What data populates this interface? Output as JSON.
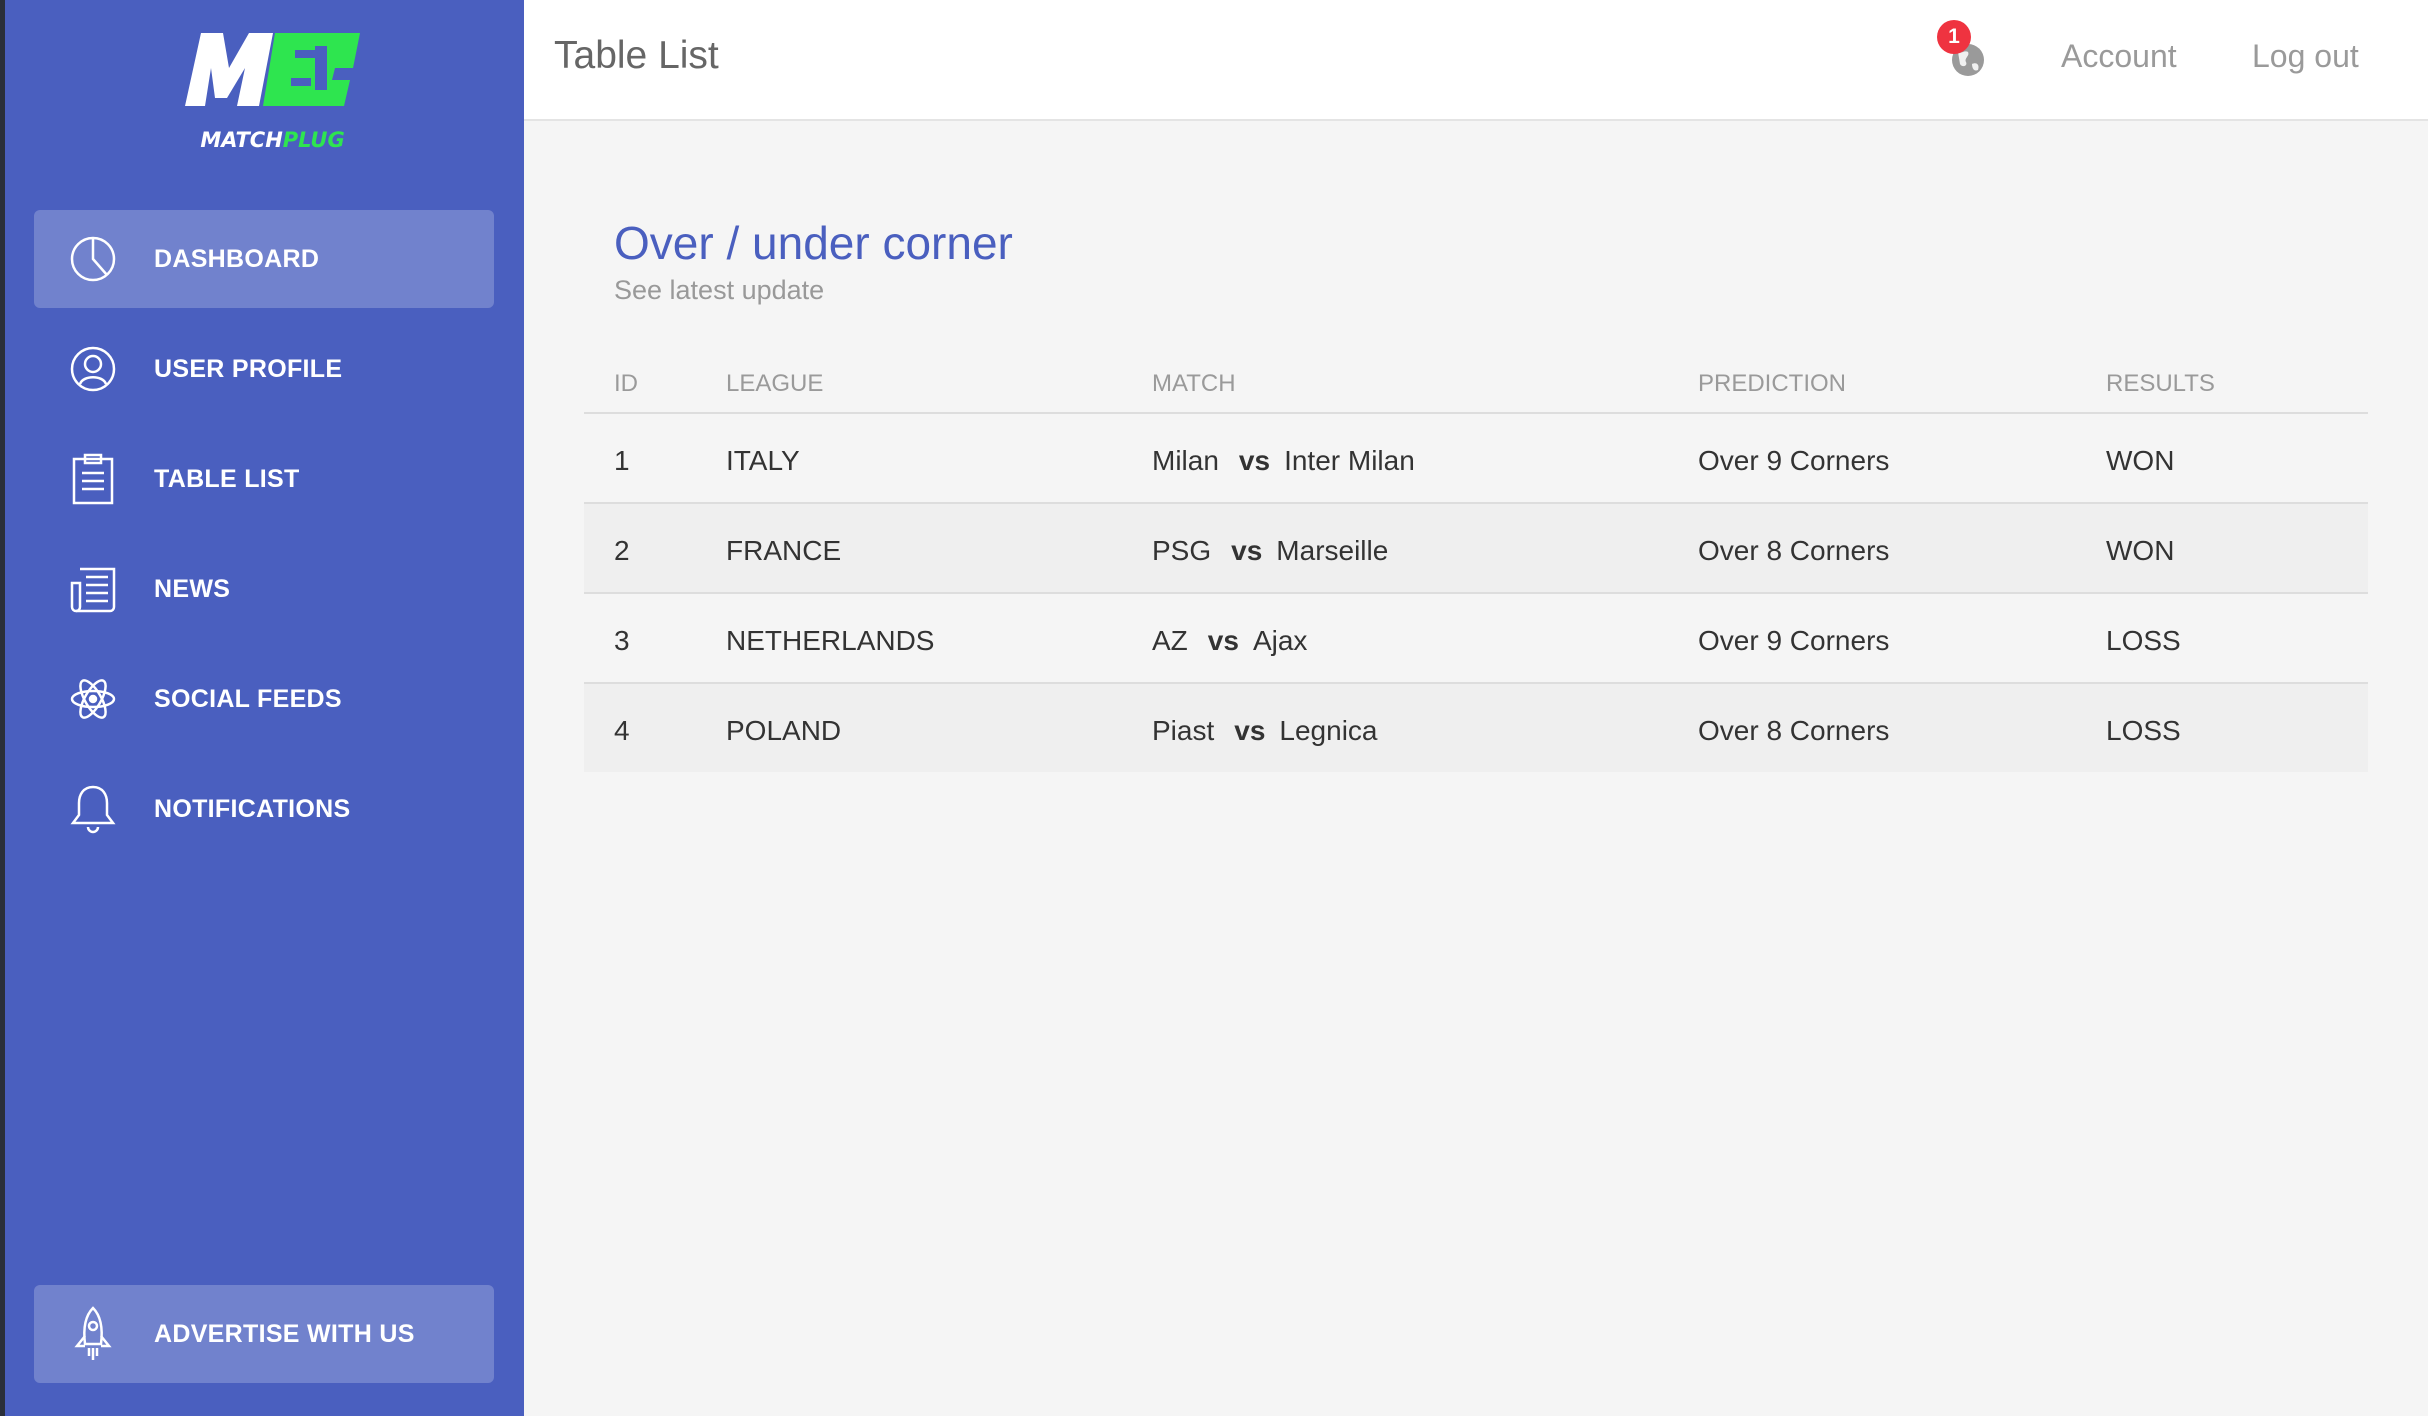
{
  "brand": {
    "logo_text_white": "MATCH",
    "logo_text_green": "PLUG",
    "brand_green": "#2ee54f",
    "sidebar_color": "#4a5fbf"
  },
  "sidebar": {
    "items": [
      {
        "label": "DASHBOARD",
        "icon": "pie-chart-icon",
        "active": true
      },
      {
        "label": "USER PROFILE",
        "icon": "user-icon"
      },
      {
        "label": "TABLE LIST",
        "icon": "clipboard-icon"
      },
      {
        "label": "NEWS",
        "icon": "newspaper-icon"
      },
      {
        "label": "SOCIAL FEEDS",
        "icon": "atom-icon"
      },
      {
        "label": "NOTIFICATIONS",
        "icon": "bell-icon"
      }
    ],
    "cta": {
      "label": "ADVERTISE WITH US",
      "icon": "rocket-icon"
    }
  },
  "header": {
    "title": "Table List",
    "notification_count": "1",
    "account_label": "Account",
    "logout_label": "Log out"
  },
  "card": {
    "title": "Over / under corner",
    "subtitle": "See latest update"
  },
  "table": {
    "columns": [
      "ID",
      "LEAGUE",
      "MATCH",
      "PREDICTION",
      "RESULTS"
    ],
    "vs_label": "vs",
    "rows": [
      {
        "id": "1",
        "league": "ITALY",
        "home": "Milan",
        "away": "Inter Milan",
        "prediction": "Over 9 Corners",
        "result": "WON"
      },
      {
        "id": "2",
        "league": "FRANCE",
        "home": "PSG",
        "away": "Marseille",
        "prediction": "Over 8 Corners",
        "result": "WON"
      },
      {
        "id": "3",
        "league": "NETHERLANDS",
        "home": "AZ",
        "away": "Ajax",
        "prediction": "Over 9 Corners",
        "result": "LOSS"
      },
      {
        "id": "4",
        "league": "POLAND",
        "home": "Piast",
        "away": "Legnica",
        "prediction": "Over 8 Corners",
        "result": "LOSS"
      }
    ]
  }
}
